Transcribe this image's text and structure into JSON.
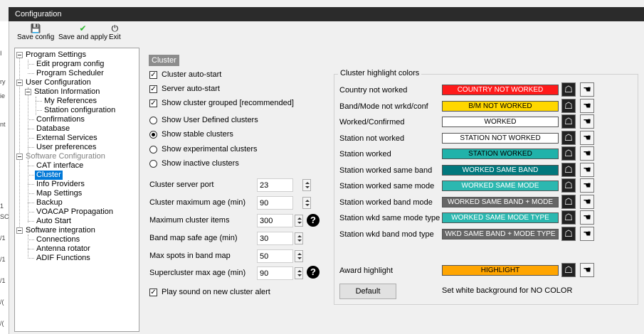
{
  "window": {
    "title": "Configuration"
  },
  "toolbar": {
    "save_config": "Save config",
    "save_apply": "Save and apply",
    "exit": "Exit"
  },
  "tree": {
    "program_settings": "Program Settings",
    "edit_program_config": "Edit program config",
    "program_scheduler": "Program Scheduler",
    "user_configuration": "User Configuration",
    "station_information": "Station Information",
    "my_references": "My References",
    "station_configuration": "Station configuration",
    "confirmations": "Confirmations",
    "database": "Database",
    "external_services": "External Services",
    "user_preferences": "User preferences",
    "software_configuration": "Software Configuration",
    "cat_interface": "CAT interface",
    "cluster": "Cluster",
    "info_providers": "Info Providers",
    "map_settings": "Map Settings",
    "backup": "Backup",
    "voacap_propagation": "VOACAP Propagation",
    "auto_start": "Auto Start",
    "software_integration": "Software integration",
    "connections": "Connections",
    "antenna_rotator": "Antenna rotator",
    "adif_functions": "ADIF Functions"
  },
  "cluster": {
    "section_title": "Cluster",
    "checkboxes": {
      "auto_start": {
        "label": "Cluster auto-start",
        "checked": true
      },
      "server_auto_start": {
        "label": "Server auto-start",
        "checked": true
      },
      "grouped": {
        "label": "Show cluster grouped [recommended]",
        "checked": true
      },
      "play_sound": {
        "label": "Play sound on new cluster alert",
        "checked": true
      }
    },
    "radios": {
      "user_defined": "Show User Defined clusters",
      "stable": "Show stable clusters",
      "experimental": "Show experimental clusters",
      "inactive": "Show inactive clusters",
      "selected": "stable"
    },
    "fields": {
      "server_port": {
        "label": "Cluster server port",
        "value": "23"
      },
      "max_age": {
        "label": "Cluster maximum age (min)",
        "value": "90"
      },
      "max_items": {
        "label": "Maximum cluster items",
        "value": "300"
      },
      "band_map_safe_age": {
        "label": "Band map safe age (min)",
        "value": "30"
      },
      "max_spots": {
        "label": "Max spots in band map",
        "value": "50"
      },
      "supercluster_max_age": {
        "label": "Supercluster max age (min)",
        "value": "90"
      }
    },
    "help_glyph": "?"
  },
  "highlight": {
    "group_title": "Cluster highlight colors",
    "rows": [
      {
        "label": "Country not worked",
        "text": "COUNTRY NOT WORKED",
        "bg": "#ff1a1a",
        "fg": "#ffffff"
      },
      {
        "label": "Band/Mode not wrkd/conf",
        "text": "B/M NOT WORKED",
        "bg": "#ffd700",
        "fg": "#000000"
      },
      {
        "label": "Worked/Confirmed",
        "text": "WORKED",
        "bg": "#ffffff",
        "fg": "#000000"
      },
      {
        "label": "Station not worked",
        "text": "STATION NOT WORKED",
        "bg": "#ffffff",
        "fg": "#000000"
      },
      {
        "label": "Station worked",
        "text": "STATION WORKED",
        "bg": "#20b2aa",
        "fg": "#000000"
      },
      {
        "label": "Station worked same band",
        "text": "WORKED SAME BAND",
        "bg": "#00787d",
        "fg": "#ffffff"
      },
      {
        "label": "Station worked same mode",
        "text": "WORKED SAME MODE",
        "bg": "#2bb8b0",
        "fg": "#ffffff"
      },
      {
        "label": "Station worked band mode",
        "text": "WORKED SAME BAND + MODE",
        "bg": "#666666",
        "fg": "#ffffff"
      },
      {
        "label": "Station wkd same mode type",
        "text": "WORKED SAME MODE TYPE",
        "bg": "#2bb8b0",
        "fg": "#ffffff"
      },
      {
        "label": "Station wkd band mod type",
        "text": "WKD SAME BAND + MODE TYPE",
        "bg": "#666666",
        "fg": "#ffffff"
      }
    ],
    "award": {
      "label": "Award highlight",
      "text": "HIGHLIGHT",
      "bg": "#ffa500",
      "fg": "#000000"
    },
    "default_button": "Default",
    "note": "Set white background for NO COLOR"
  },
  "colors": {
    "selection": "#0078d7",
    "titlebar": "#2b2b2b"
  },
  "icons": {
    "save": "save-icon",
    "apply": "checkmark-icon",
    "exit": "power-icon",
    "paint_bucket": "paint-bucket-icon"
  }
}
